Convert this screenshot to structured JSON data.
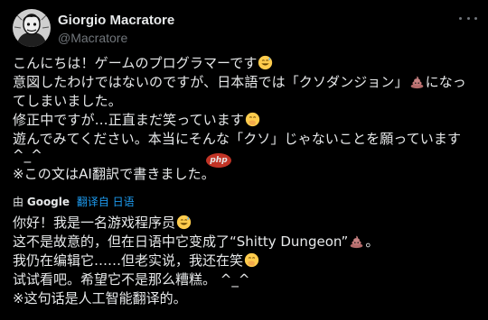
{
  "author": {
    "name": "Giorgio Macratore",
    "handle": "@Macratore"
  },
  "original": {
    "lines": [
      {
        "before": "こんにちは！ゲームのプログラマーです",
        "emoji": "grin-sweat-emoji",
        "after": ""
      },
      {
        "before": "意図したわけではないのですが、日本語では「クソダンジョン」",
        "emoji": "poop-emoji",
        "after": "になっ"
      },
      {
        "before": "てしまいました。",
        "emoji": "",
        "after": ""
      },
      {
        "before": "修正中ですが…正直まだ笑っています",
        "emoji": "hand-over-mouth-emoji",
        "after": ""
      },
      {
        "before": "遊んでみてください。本当にそんな「クソ」じゃないことを願っています",
        "emoji": "",
        "after": ""
      },
      {
        "before": "^_^",
        "emoji": "",
        "after": ""
      },
      {
        "before": "※この文はAI翻訳で書きました。",
        "emoji": "",
        "after": ""
      }
    ]
  },
  "translation_bar": {
    "prefix": "由",
    "provider": "Google",
    "link": "翻译自 日语"
  },
  "translated": {
    "lines": [
      {
        "before": "你好！我是一名游戏程序员",
        "emoji": "grin-sweat-emoji",
        "after": ""
      },
      {
        "before": "这不是故意的，但在日语中它变成了“Shitty Dungeon”",
        "emoji": "poop-emoji",
        "after": "。"
      },
      {
        "before": "我仍在编辑它……但老实说，我还在笑",
        "emoji": "hand-over-mouth-emoji",
        "after": ""
      },
      {
        "before": "试试看吧。希望它不是那么糟糕。 ^_^",
        "emoji": "",
        "after": ""
      },
      {
        "before": "※这句话是人工智能翻译的。",
        "emoji": "",
        "after": ""
      }
    ]
  },
  "watermark": {
    "text": "php"
  },
  "colors": {
    "background": "#000000",
    "text": "#e7e9ea",
    "secondary": "#71767b",
    "link": "#1d9bf0"
  }
}
